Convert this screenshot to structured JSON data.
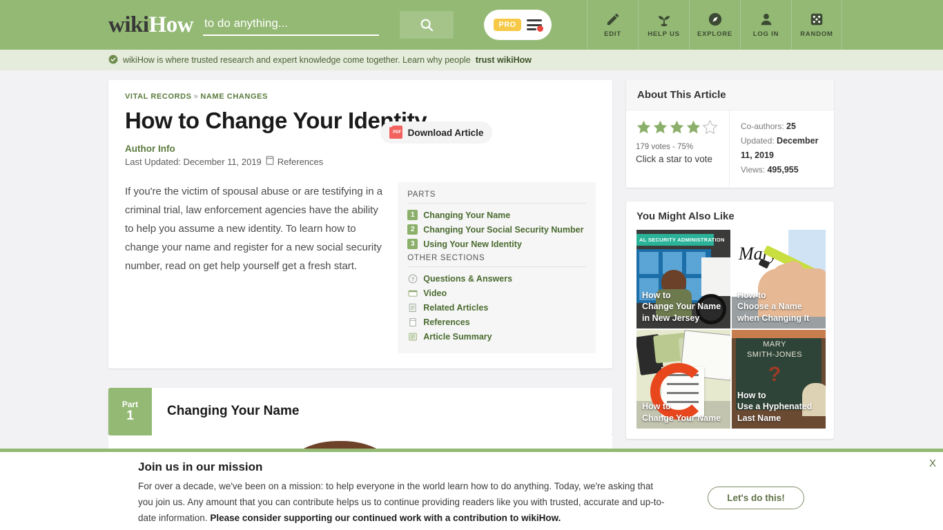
{
  "header": {
    "logo_wiki": "wiki",
    "logo_how": "How",
    "search_placeholder": "to do anything...",
    "search_value": "",
    "search_icon": "search-icon",
    "pro_label": "PRO",
    "nav": [
      {
        "label": "EDIT",
        "icon": "pencil-icon"
      },
      {
        "label": "HELP US",
        "icon": "sprout-icon"
      },
      {
        "label": "EXPLORE",
        "icon": "compass-icon"
      },
      {
        "label": "LOG IN",
        "icon": "user-icon"
      },
      {
        "label": "RANDOM",
        "icon": "dice-icon"
      }
    ]
  },
  "trust_banner": {
    "icon": "check-badge-icon",
    "text": "wikiHow is where trusted research and expert knowledge come together. Learn why people ",
    "link": "trust wikiHow"
  },
  "article": {
    "breadcrumb": {
      "first": "VITAL RECORDS",
      "separator": "»",
      "second": "NAME CHANGES"
    },
    "title": "How to Change Your Identity",
    "author_info_label": "Author Info",
    "last_updated": "Last Updated: December 11, 2019",
    "references_label": "References",
    "download_label": "Download Article",
    "download_icon": "pdf-icon",
    "intro": "If you're the victim of spousal abuse or are testifying in a criminal trial, law enforcement agencies have the ability to help you assume a new identity. To learn how to change your name and register for a new social security number, read on get help yourself get a fresh start."
  },
  "toc": {
    "parts_heading": "PARTS",
    "parts": [
      {
        "num": "1",
        "label": "Changing Your Name"
      },
      {
        "num": "2",
        "label": "Changing Your Social Security Number"
      },
      {
        "num": "3",
        "label": "Using Your New Identity"
      }
    ],
    "other_heading": "OTHER SECTIONS",
    "other": [
      {
        "icon": "question-circle-icon",
        "glyph": "?",
        "label": "Questions & Answers"
      },
      {
        "icon": "video-icon",
        "glyph": "▦",
        "label": "Video"
      },
      {
        "icon": "article-icon",
        "glyph": "▤",
        "label": "Related Articles"
      },
      {
        "icon": "references-icon",
        "glyph": "▯",
        "label": "References"
      },
      {
        "icon": "summary-icon",
        "glyph": "▤",
        "label": "Article Summary"
      }
    ]
  },
  "part_section": {
    "part_word": "Part",
    "part_number": "1",
    "part_title": "Changing Your Name"
  },
  "about": {
    "heading": "About This Article",
    "stars_filled": 4,
    "stars_total": 5,
    "votes_text": "179 votes - 75%",
    "click_text": "Click a star to vote",
    "coauthors_label": "Co-authors:",
    "coauthors_value": "25",
    "updated_label": "Updated:",
    "updated_value": "December 11, 2019",
    "views_label": "Views:",
    "views_value": "495,955"
  },
  "ymal": {
    "heading": "You Might Also Like",
    "items": [
      {
        "howto": "How to",
        "title": "Change Your Name in New Jersey",
        "art": "t1",
        "sign_text": "AL SECURITY ADMINISTRATION"
      },
      {
        "howto": "How to",
        "title": "Choose a Name when Changing It",
        "art": "t2",
        "signature": "Mary"
      },
      {
        "howto": "How to",
        "title": "Change Your Name",
        "art": "t3"
      },
      {
        "howto": "How to",
        "title": "Use a Hyphenated Last Name",
        "art": "t4",
        "chalk_line1": "MARY",
        "chalk_line2": "SMITH-JONES",
        "chalk_q": "?"
      }
    ]
  },
  "bottom_banner": {
    "title": "Join us in our mission",
    "text_1": "For over a decade, we've been on a mission: to help everyone in the world learn how to do anything. Today, we're asking that you join us. Any amount that you can contribute helps us to continue providing readers like you with trusted, accurate and up-to-date information. ",
    "text_bold": "Please consider supporting our continued work with a contribution to wikiHow.",
    "button_label": "Let's do this!",
    "close_label": "X"
  },
  "colors": {
    "brand_green": "#93b974",
    "trust_bg": "#e5ecdc",
    "page_bg": "#f2f1f4",
    "link_green": "#4a6b2f",
    "pro_yellow": "#f7c948",
    "pdf_red": "#f2635e"
  }
}
